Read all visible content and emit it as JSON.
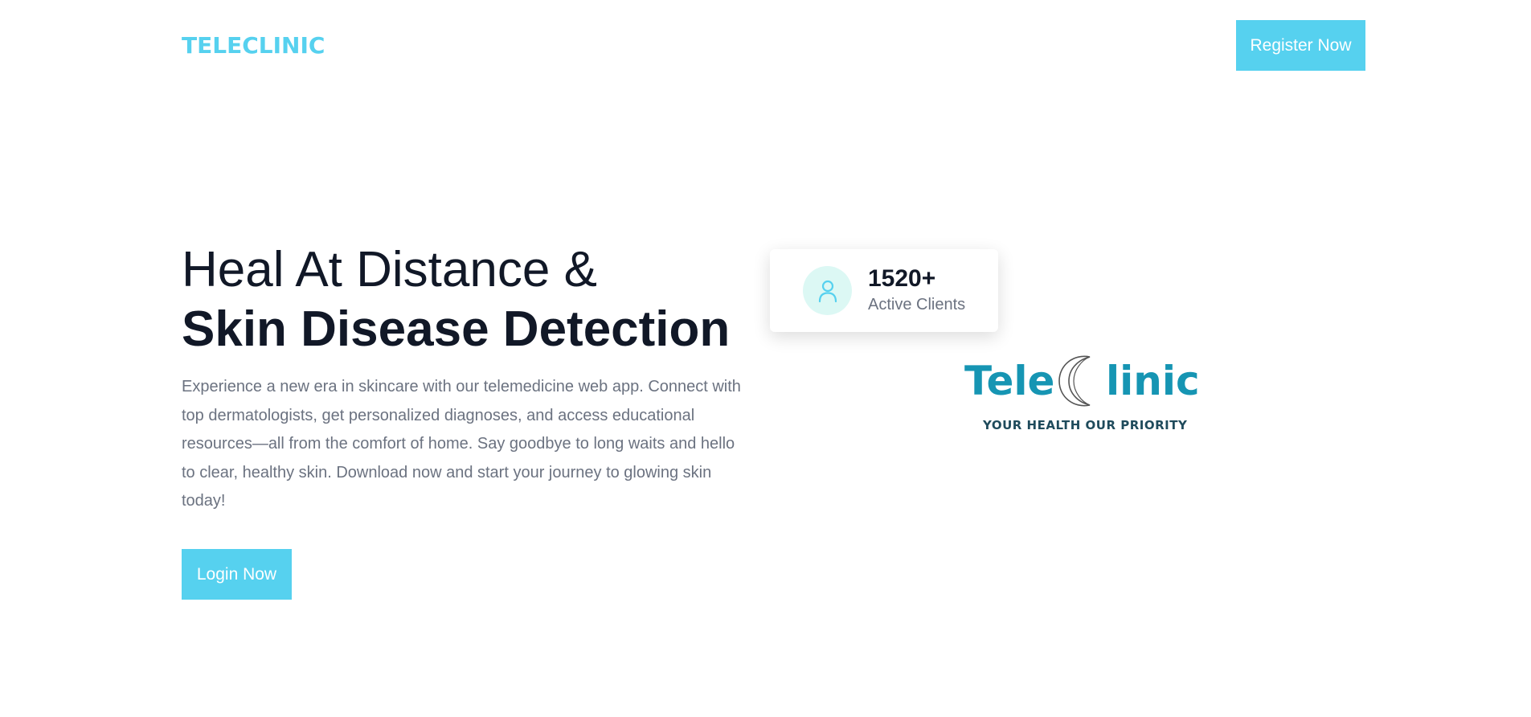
{
  "header": {
    "brand": "TELECLINIC",
    "register_label": "Register Now"
  },
  "hero": {
    "title_line1": "Heal At Distance &",
    "title_line2": "Skin Disease Detection",
    "description": "Experience a new era in skincare with our telemedicine web app. Connect with top dermatologists, get personalized diagnoses, and access educational resources—all from the comfort of home. Say goodbye to long waits and hello to clear, healthy skin. Download now and start your journey to glowing skin today!",
    "login_label": "Login Now"
  },
  "stat_card": {
    "icon": "user-icon",
    "value": "1520+",
    "label": "Active Clients"
  },
  "logo": {
    "word_start": "Tele",
    "word_end": "linic",
    "tagline": "YOUR HEALTH OUR PRIORITY"
  },
  "colors": {
    "accent": "#56d1ef",
    "heading": "#111827",
    "body_text": "#6b7280",
    "logo_teal": "#1695b3",
    "logo_tagline": "#1f4b5c",
    "icon_bg": "#dcf8f4"
  }
}
